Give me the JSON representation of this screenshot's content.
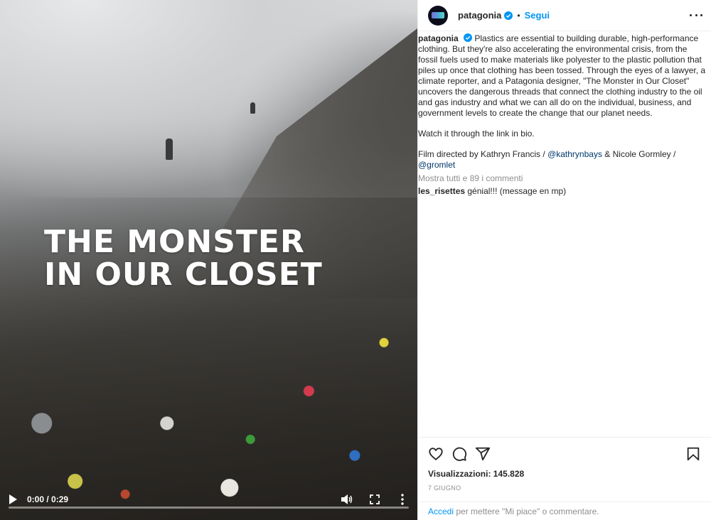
{
  "video": {
    "headline_line1": "THE MONSTER",
    "headline_line2": "IN OUR CLOSET",
    "time": "0:00 / 0:29",
    "progress": 0,
    "icons": [
      "play-icon",
      "volume-icon",
      "fullscreen-icon",
      "more-vertical-icon"
    ]
  },
  "header": {
    "username": "patagonia",
    "separator": "•",
    "follow_label": "Segui",
    "icons": [
      "verified-badge-icon",
      "more-horizontal-icon"
    ]
  },
  "caption": {
    "username": "patagonia",
    "text": "Plastics are essential to building durable, high-performance clothing. But they're also accelerating the environmental crisis, from the fossil fuels used to make materials like polyester to the plastic pollution that piles up once that clothing has been tossed. Through the eyes of a lawyer, a climate reporter, and a Patagonia designer, \"The Monster in Our Closet\" uncovers the dangerous threads that connect the clothing industry to the oil and gas industry and what we can all do on the individual, business, and government levels to create the change that our planet needs.",
    "watch_line": "Watch it through the link in bio.",
    "credits_prefix": "Film directed by Kathryn Francis / ",
    "credit_link_1": "@kathrynbays",
    "credits_middle": " & Nicole Gormley / ",
    "credit_link_2": "@gromlet",
    "show_comments": "Mostra tutti e 89 i commenti"
  },
  "comment": {
    "username": "les_risettes",
    "text": " génial!!! (message en mp)"
  },
  "actions": {
    "icons": [
      "heart-icon",
      "comment-icon",
      "share-icon",
      "bookmark-icon"
    ],
    "views": "Visualizzazioni: 145.828",
    "date": "7 GIUGNO"
  },
  "login": {
    "link": "Accedi",
    "text": " per mettere \"Mi piace\" o commentare."
  },
  "colors": {
    "accent": "#0095f6",
    "text": "#262626",
    "muted": "#8e8e8e",
    "link_dark": "#00376b",
    "border": "#efefef"
  }
}
